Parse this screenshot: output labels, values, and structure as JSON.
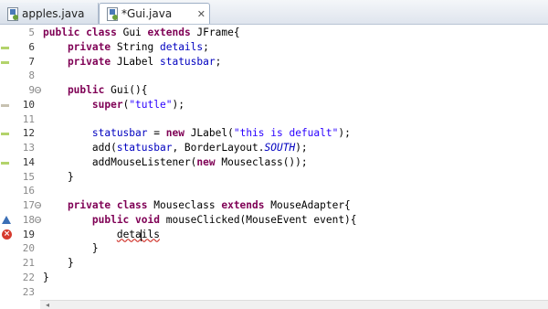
{
  "tabs": [
    {
      "label": "apples.java",
      "icon": "java-file-icon",
      "active": false
    },
    {
      "label": "*Gui.java",
      "icon": "java-file-icon",
      "active": true,
      "close": "✕"
    }
  ],
  "editor": {
    "lines": [
      {
        "num": "5",
        "code": [
          {
            "t": "public ",
            "c": "kw"
          },
          {
            "t": "class ",
            "c": "kw"
          },
          {
            "t": "Gui "
          },
          {
            "t": "extends ",
            "c": "kw"
          },
          {
            "t": "JFrame{"
          }
        ]
      },
      {
        "num": "6",
        "code": [
          {
            "t": "    private ",
            "c": "kw"
          },
          {
            "t": "String "
          },
          {
            "t": "details",
            "c": "fld"
          },
          {
            "t": ";"
          }
        ]
      },
      {
        "num": "7",
        "code": [
          {
            "t": "    private ",
            "c": "kw"
          },
          {
            "t": "JLabel "
          },
          {
            "t": "statusbar",
            "c": "fld"
          },
          {
            "t": ";"
          }
        ]
      },
      {
        "num": "8",
        "code": []
      },
      {
        "num": "9",
        "code": [
          {
            "t": "    public ",
            "c": "kw"
          },
          {
            "t": "Gui(){"
          }
        ]
      },
      {
        "num": "10",
        "code": [
          {
            "t": "        super",
            "c": "kw"
          },
          {
            "t": "("
          },
          {
            "t": "\"tutle\"",
            "c": "str"
          },
          {
            "t": ");"
          }
        ]
      },
      {
        "num": "11",
        "code": []
      },
      {
        "num": "12",
        "code": [
          {
            "t": "        statusbar",
            "c": "fld"
          },
          {
            "t": " = "
          },
          {
            "t": "new ",
            "c": "kw"
          },
          {
            "t": "JLabel("
          },
          {
            "t": "\"this is defualt\"",
            "c": "str"
          },
          {
            "t": ");"
          }
        ]
      },
      {
        "num": "13",
        "code": [
          {
            "t": "        add("
          },
          {
            "t": "statusbar",
            "c": "fld"
          },
          {
            "t": ", BorderLayout."
          },
          {
            "t": "SOUTH",
            "c": "ital"
          },
          {
            "t": ");"
          }
        ]
      },
      {
        "num": "14",
        "code": [
          {
            "t": "        addMouseListener("
          },
          {
            "t": "new ",
            "c": "kw"
          },
          {
            "t": "Mouseclass());"
          }
        ]
      },
      {
        "num": "15",
        "code": [
          {
            "t": "    }"
          }
        ]
      },
      {
        "num": "16",
        "code": []
      },
      {
        "num": "17",
        "code": [
          {
            "t": "    private ",
            "c": "kw"
          },
          {
            "t": "class ",
            "c": "kw"
          },
          {
            "t": "Mouseclass "
          },
          {
            "t": "extends ",
            "c": "kw"
          },
          {
            "t": "MouseAdapter{"
          }
        ]
      },
      {
        "num": "18",
        "code": [
          {
            "t": "        public ",
            "c": "kw"
          },
          {
            "t": "void ",
            "c": "kw"
          },
          {
            "t": "mouseClicked(MouseEvent event){"
          }
        ]
      },
      {
        "num": "19",
        "code": [
          {
            "t": "            "
          },
          {
            "t": "details",
            "c": "squig"
          }
        ]
      },
      {
        "num": "20",
        "code": [
          {
            "t": "        }"
          }
        ]
      },
      {
        "num": "21",
        "code": [
          {
            "t": "    }"
          }
        ]
      },
      {
        "num": "22",
        "code": [
          {
            "t": "}"
          }
        ]
      },
      {
        "num": "23",
        "code": []
      }
    ]
  }
}
